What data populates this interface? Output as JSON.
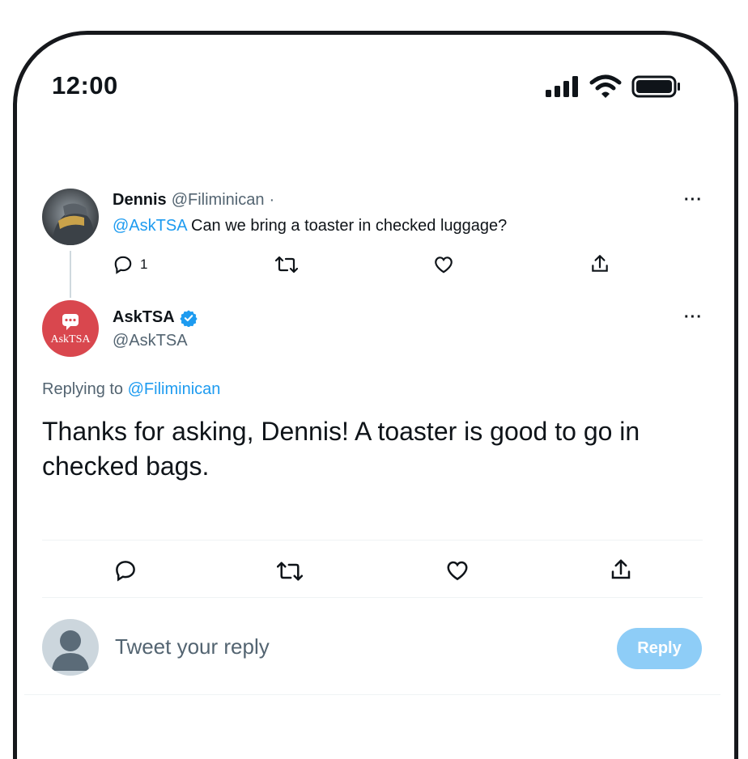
{
  "status_bar": {
    "time": "12:00"
  },
  "original_tweet": {
    "display_name": "Dennis",
    "handle": "@Filiminican",
    "separator": "·",
    "mention": "@AskTSA",
    "text": " Can we bring a toaster in checked luggage?",
    "reply_count": "1",
    "more": "···"
  },
  "reply_tweet": {
    "avatar_label": "AskTSA",
    "display_name": "AskTSA",
    "handle": "@AskTSA",
    "verified": true,
    "replying_to_prefix": "Replying to ",
    "replying_to_handle": "@Filiminican",
    "text": "Thanks for asking, Dennis! A toaster is good to go in checked bags.",
    "more": "···"
  },
  "compose": {
    "placeholder": "Tweet your reply",
    "button_label": "Reply"
  },
  "colors": {
    "accent": "#1d9bf0",
    "asktsa_avatar": "#d9474e",
    "reply_button_disabled": "#8ecdf7"
  },
  "icons": [
    "signal-icon",
    "wifi-icon",
    "battery-icon",
    "reply-icon",
    "retweet-icon",
    "like-icon",
    "share-icon",
    "verified-badge-icon",
    "more-icon",
    "chat-bubble-icon",
    "default-avatar-icon"
  ]
}
